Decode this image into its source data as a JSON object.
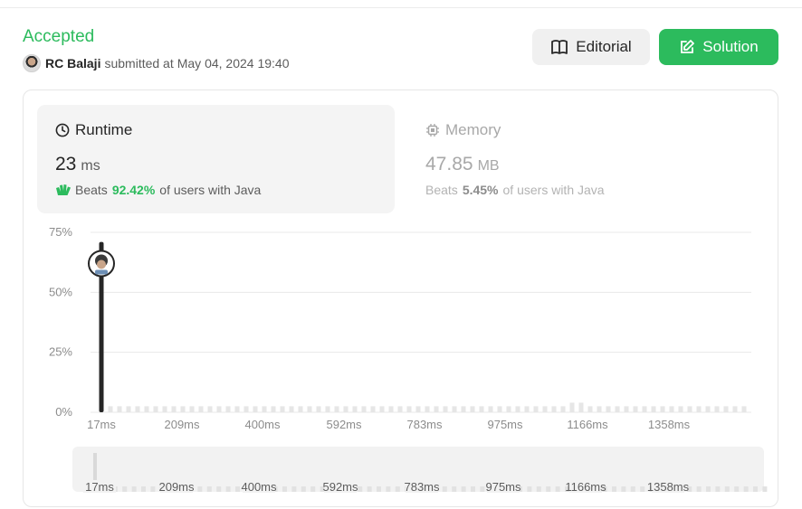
{
  "header": {
    "status": "Accepted",
    "user": "RC Balaji",
    "submitted_text": "submitted at",
    "timestamp": "May 04, 2024 19:40",
    "editorial_label": "Editorial",
    "solution_label": "Solution"
  },
  "colors": {
    "accent": "#2cbb5d",
    "bar": "#262626",
    "faint_bar": "#e6e6e6"
  },
  "runtime": {
    "title": "Runtime",
    "value": "23",
    "unit": "ms",
    "beats_label": "Beats",
    "beats_pct": "92.42%",
    "beats_suffix": "of users with Java",
    "icon": "clock-icon"
  },
  "memory": {
    "title": "Memory",
    "value": "47.85",
    "unit": "MB",
    "beats_label": "Beats",
    "beats_pct": "5.45%",
    "beats_suffix": "of users with Java",
    "icon": "chip-icon"
  },
  "chart_data": {
    "type": "bar",
    "ylim": [
      0,
      75
    ],
    "ytick_labels": [
      "75%",
      "50%",
      "25%",
      "0%"
    ],
    "ytick_values": [
      75,
      50,
      25,
      0
    ],
    "xtick_labels": [
      "17ms",
      "209ms",
      "400ms",
      "592ms",
      "783ms",
      "975ms",
      "1166ms",
      "1358ms"
    ],
    "grid": true,
    "highlight": {
      "x": "17ms",
      "value": 71,
      "marker": "user-avatar"
    },
    "bucket_count": 72,
    "bars": [
      {
        "bucket": 0,
        "value": 71
      },
      {
        "bucket": 52,
        "value": 4
      },
      {
        "bucket": 53,
        "value": 4
      }
    ],
    "baseline_value": 2.5
  },
  "range_selector": {
    "xtick_labels": [
      "17ms",
      "209ms",
      "400ms",
      "592ms",
      "783ms",
      "975ms",
      "1166ms",
      "1358ms"
    ]
  }
}
